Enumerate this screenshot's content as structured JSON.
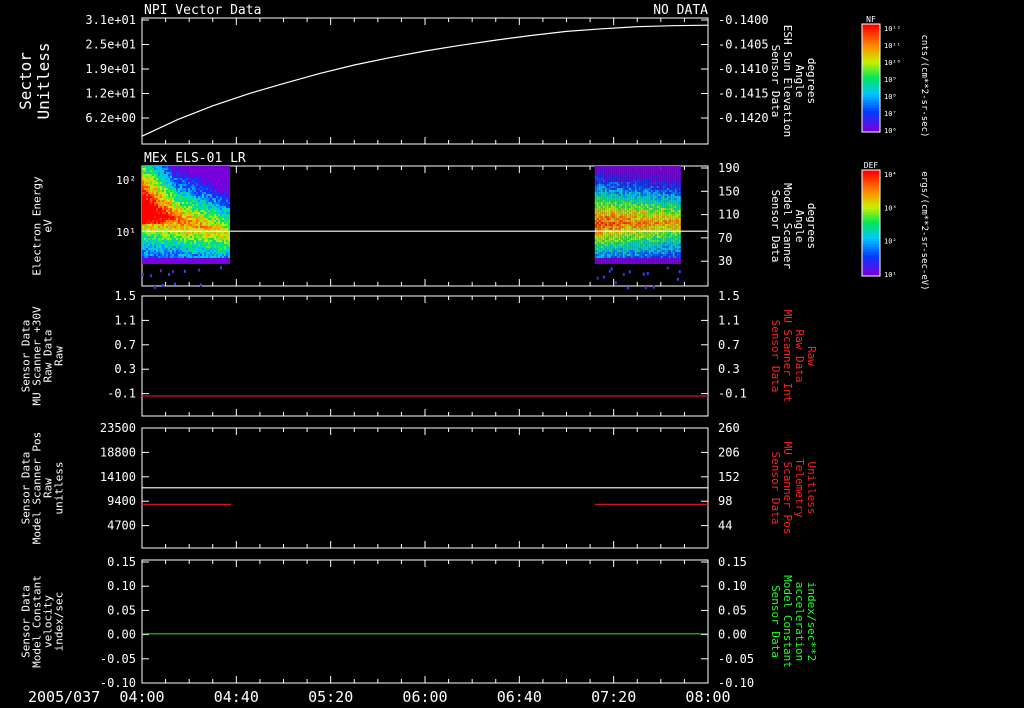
{
  "figure": {
    "date_label": "2005/037",
    "x_ticks": [
      "04:00",
      "04:40",
      "05:20",
      "06:00",
      "06:40",
      "07:20",
      "08:00"
    ],
    "time_range_hours": [
      4.0,
      8.0
    ]
  },
  "colorbars": [
    {
      "label": "NF",
      "units": "cnts/(cm**2-sr-sec)",
      "ticks": [
        "10¹²",
        "10¹¹",
        "10¹⁰",
        "10⁹",
        "10⁸",
        "10⁷",
        "10⁶"
      ]
    },
    {
      "label": "DEF",
      "units": "ergs/(cm**2-sr-sec-eV)",
      "ticks": [
        "10⁴",
        "10³",
        "10²",
        "10¹"
      ]
    }
  ],
  "chart_data": [
    {
      "type": "line",
      "title_left": "NPI Vector Data",
      "title_right": "NO DATA",
      "ylabel_left": [
        "Sector",
        "Unitless"
      ],
      "ylabel_right": [
        "Sensor Data",
        "ESH Sun Elevation",
        "Angle",
        "degrees"
      ],
      "yticks_left": [
        "3.1e+01",
        "2.5e+01",
        "1.9e+01",
        "1.2e+01",
        "6.2e+00"
      ],
      "yticks_right": [
        "-0.1400",
        "-0.1405",
        "-0.1410",
        "-0.1415",
        "-0.1420"
      ],
      "ylim_right": [
        -0.1423,
        -0.1399
      ],
      "series": [
        {
          "color": "#ffffff",
          "axis": "right",
          "x": [
            4.0,
            4.25,
            4.5,
            4.75,
            5.0,
            5.25,
            5.5,
            5.75,
            6.0,
            6.25,
            6.5,
            6.75,
            7.0,
            7.25,
            7.5,
            7.75,
            8.0
          ],
          "y": [
            -0.14215,
            -0.14183,
            -0.14156,
            -0.14133,
            -0.14113,
            -0.14094,
            -0.14077,
            -0.14063,
            -0.1405,
            -0.14039,
            -0.14029,
            -0.1402,
            -0.14012,
            -0.14007,
            -0.14003,
            -0.14001,
            -0.14
          ]
        }
      ]
    },
    {
      "type": "heatmap",
      "title_left": "MEx ELS-01 LR",
      "ylabel_left": [
        "Electron Energy",
        "eV"
      ],
      "ylabel_right": [
        "Sensor Data",
        "Model Scanner",
        "Angle",
        "degrees"
      ],
      "yticks_left": [
        "10²",
        "10¹"
      ],
      "yticks_right": [
        "190",
        "150",
        "110",
        "70",
        "30"
      ],
      "ylim_right": [
        0,
        190
      ],
      "yscale_left": "log",
      "ylim_left": [
        1.2,
        170
      ],
      "data_intervals_hours": [
        [
          4.0,
          4.62
        ],
        [
          7.2,
          7.8
        ]
      ],
      "energy_coverage_ev": [
        3.2,
        170
      ],
      "series": [
        {
          "color": "#ffffff",
          "axis": "right",
          "x": [
            4.0,
            8.0
          ],
          "y": [
            90,
            90
          ]
        }
      ]
    },
    {
      "type": "line",
      "ylabel_left": [
        "Sensor Data",
        "MU Scanner +30V",
        "Raw Data",
        "Raw"
      ],
      "ylabel_right": [
        "Sensor Data",
        "MU Scanner Int",
        "Raw Data",
        "Raw"
      ],
      "ylabel_right_color": "#ff2020",
      "yticks_left": [
        "1.5",
        "1.1",
        "0.7",
        "0.3",
        "-0.1"
      ],
      "yticks_right": [
        "1.5",
        "1.1",
        "0.7",
        "0.3",
        "-0.1"
      ],
      "ylim_right": [
        -0.3,
        1.5
      ],
      "series": [
        {
          "color": "#d01818",
          "axis": "right",
          "x": [
            4.0,
            8.0
          ],
          "y": [
            0.0,
            0.0
          ]
        }
      ]
    },
    {
      "type": "line",
      "ylabel_left": [
        "Sensor Data",
        "Model Scanner Pos",
        "Raw",
        "unitless"
      ],
      "ylabel_right": [
        "Sensor Data",
        "MU Scanner Pos",
        "Telemetry",
        "Unitless"
      ],
      "ylabel_right_color": "#ff2020",
      "yticks_left": [
        "23500",
        "18800",
        "14100",
        "9400",
        "4700"
      ],
      "yticks_right": [
        "260",
        "206",
        "152",
        "98",
        "44"
      ],
      "ylim_left": [
        0,
        23500
      ],
      "ylim_right": [
        0,
        260
      ],
      "series": [
        {
          "color": "#ffffff",
          "axis": "left",
          "x": [
            4.0,
            8.0
          ],
          "y": [
            11600,
            11600
          ]
        },
        {
          "color": "#d01818",
          "axis": "left",
          "x": [
            4.0,
            4.63
          ],
          "y": [
            8400,
            8400
          ]
        },
        {
          "color": "#d01818",
          "axis": "left",
          "x": [
            7.2,
            8.0
          ],
          "y": [
            8400,
            8400
          ]
        }
      ]
    },
    {
      "type": "line",
      "ylabel_left": [
        "Sensor Data",
        "Model Constant",
        "velocity",
        "index/sec"
      ],
      "ylabel_right": [
        "Sensor Data",
        "Model Constant",
        "acceleration",
        "index/sec**2"
      ],
      "ylabel_right_color": "#20ff20",
      "yticks_left": [
        "0.15",
        "0.10",
        "0.05",
        "0.00",
        "-0.05",
        "-0.10"
      ],
      "yticks_right": [
        "0.15",
        "0.10",
        "0.05",
        "0.00",
        "-0.05",
        "-0.10"
      ],
      "ylim_left": [
        -0.1,
        0.15
      ],
      "series": [
        {
          "color": "#20d020",
          "axis": "left",
          "x": [
            4.0,
            8.0
          ],
          "y": [
            0.0,
            0.0
          ]
        }
      ]
    }
  ]
}
